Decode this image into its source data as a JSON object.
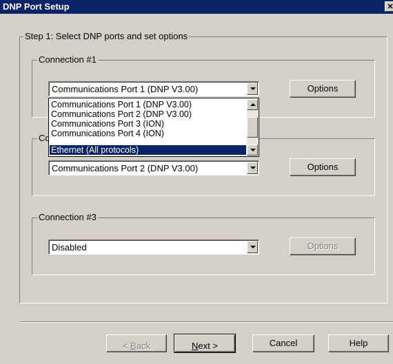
{
  "window": {
    "title": "DNP Port Setup",
    "close_glyph": "✕"
  },
  "step": {
    "label": "Step 1: Select DNP ports and set options"
  },
  "connections": [
    {
      "label": "Connection #1",
      "selected": "Communications Port 1 (DNP V3.00)",
      "options_label": "Options",
      "options_enabled": true
    },
    {
      "label": "Connection #2",
      "selected": "Communications Port 2 (DNP V3.00)",
      "options_label": "Options",
      "options_enabled": true
    },
    {
      "label": "Connection #3",
      "selected": "Disabled",
      "options_label": "Options",
      "options_enabled": false
    }
  ],
  "dropdown": {
    "items": [
      "Communications Port 1 (DNP V3.00)",
      "Communications Port 2 (DNP V3.00)",
      "Communications Port 3 (ION)",
      "Communications Port 4 (ION)",
      "Ethernet (All protocols)"
    ],
    "highlighted": "Ethernet (All protocols)"
  },
  "footer": {
    "back_label_prefix": "< ",
    "back_label_accel": "B",
    "back_label_rest": "ack",
    "next_label_accel": "N",
    "next_label_rest": "ext >",
    "cancel_label": "Cancel",
    "help_label": "Help"
  }
}
